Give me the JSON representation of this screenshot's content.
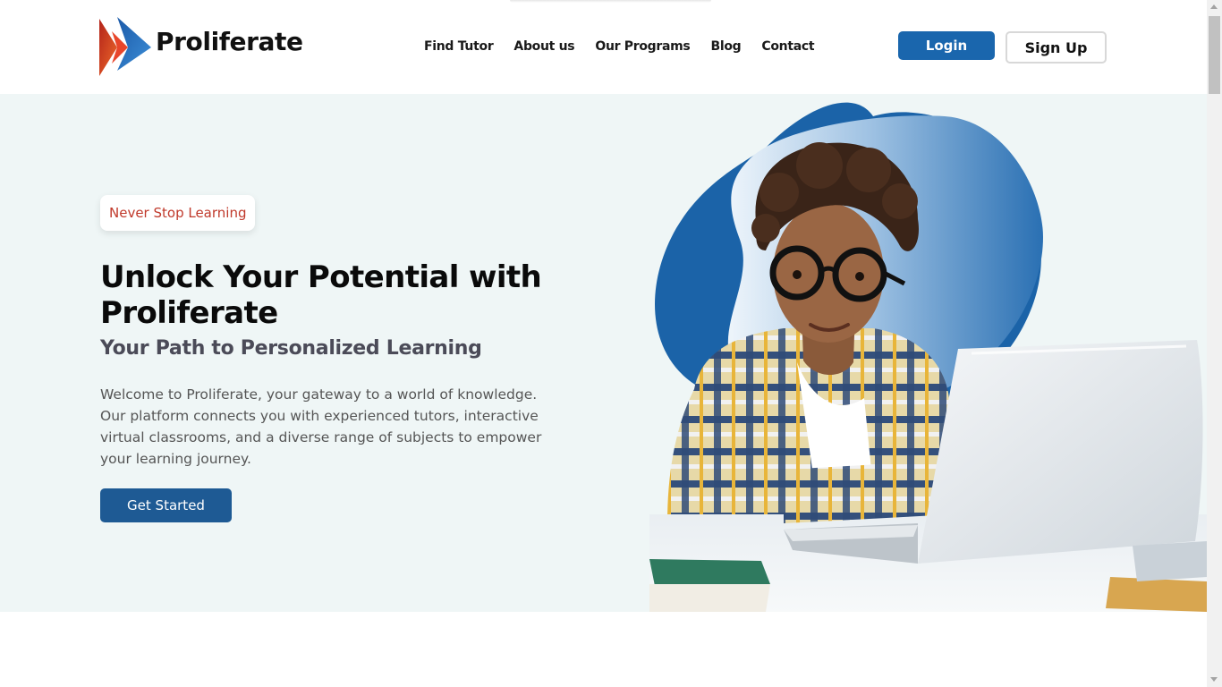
{
  "brand": {
    "name": "Proliferate"
  },
  "nav": {
    "items": [
      {
        "label": "Find Tutor"
      },
      {
        "label": "About us"
      },
      {
        "label": "Our Programs"
      },
      {
        "label": "Blog"
      },
      {
        "label": "Contact"
      }
    ]
  },
  "auth": {
    "login_label": "Login",
    "signup_label": "Sign Up"
  },
  "hero": {
    "tag": "Never Stop Learning",
    "headline": "Unlock Your Potential with Proliferate",
    "subheadline": "Your Path to Personalized Learning",
    "description": "Welcome to Proliferate, your gateway to a world of knowledge. Our platform connects you with experienced tutors, interactive virtual classrooms, and a diverse range of subjects to empower your learning journey.",
    "cta_label": "Get Started",
    "image_icon": "student-with-laptop-illustration"
  },
  "colors": {
    "primary_blue": "#1a66ad",
    "cta_blue": "#1e5a94",
    "tag_red": "#c0392b",
    "hero_bg": "#eff6f6",
    "logo_red": "#e03a1f",
    "logo_blue": "#2a73c4"
  }
}
